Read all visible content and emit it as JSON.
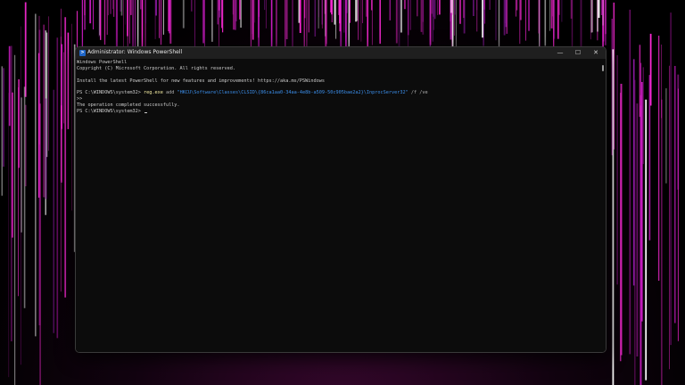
{
  "wallpaper": {
    "colors": [
      "#ff2ad8",
      "#c81bc0",
      "#ffffff",
      "#8a1aa0"
    ]
  },
  "window": {
    "title": "Administrator: Windows PowerShell",
    "icon": "powershell-icon",
    "controls": {
      "minimize": "—",
      "maximize": "☐",
      "close": "✕"
    }
  },
  "terminal": {
    "line1": "Windows PowerShell",
    "line2": "Copyright (C) Microsoft Corporation. All rights reserved.",
    "line4": "Install the latest PowerShell for new features and improvements! https://aka.ms/PSWindows",
    "prompt1": "PS C:\\WINDOWS\\system32> ",
    "cmd_exe": "reg.exe",
    "cmd_add": " add ",
    "cmd_key": "\"HKCU\\Software\\Classes\\CLSID\\{86ca1aa0-34aa-4e8b-a509-50c905bae2a2}\\InprocServer32\"",
    "cmd_args": " /f /ve",
    "continuation": ">>",
    "result": "The operation completed successfully.",
    "prompt2": "PS C:\\WINDOWS\\system32> "
  }
}
